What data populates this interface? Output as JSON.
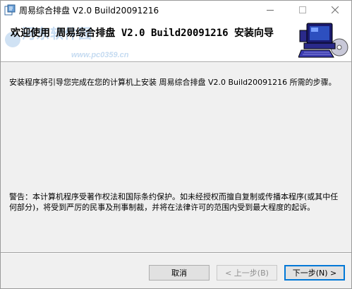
{
  "window": {
    "title": "周易综合排盘 V2.0 Build20091216"
  },
  "header": {
    "title": "欢迎使用 周易综合排盘 V2.0 Build20091216 安装向导",
    "watermark": "河东软件园",
    "watermark_url": "www.pc0359.cn"
  },
  "body": {
    "intro": "安装程序将引导您完成在您的计算机上安装 周易综合排盘 V2.0 Build20091216 所需的步骤。",
    "warning": "警告：本计算机程序受著作权法和国际条约保护。如未经授权而擅自复制或传播本程序(或其中任何部分)，将受到严厉的民事及刑事制裁，并将在法律许可的范围内受到最大程度的起诉。"
  },
  "buttons": {
    "cancel": "取消",
    "back": "< 上一步(B)",
    "next": "下一步(N) >"
  },
  "icons": {
    "app": "app-icon",
    "minimize": "minimize-icon",
    "maximize": "maximize-icon",
    "close": "close-icon",
    "banner": "computer-icon"
  }
}
